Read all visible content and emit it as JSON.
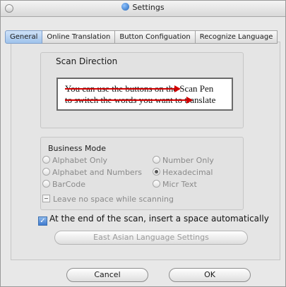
{
  "window": {
    "title": "Settings"
  },
  "tabs": [
    {
      "label": "General"
    },
    {
      "label": "Online Translation"
    },
    {
      "label": "Button Configuation"
    },
    {
      "label": "Recognize Language"
    }
  ],
  "scan_direction": {
    "label": "Scan Direction",
    "preview_line1": "You can use the buttons on the Scan Pen",
    "preview_line2": "to switch the words you want to translate"
  },
  "business_mode": {
    "label": "Business Mode",
    "options": [
      {
        "label": "Alphabet Only",
        "selected": false
      },
      {
        "label": "Number Only",
        "selected": false
      },
      {
        "label": "Alphabet and Numbers",
        "selected": false
      },
      {
        "label": "Hexadecimal",
        "selected": true
      },
      {
        "label": "BarCode",
        "selected": false
      },
      {
        "label": "Micr Text",
        "selected": false
      }
    ],
    "leave_space_label": "Leave no space while scanning"
  },
  "auto_space_label": "At the end of the scan, insert a space automatically",
  "east_asian_button": "East Asian Language Settings",
  "buttons": {
    "cancel": "Cancel",
    "ok": "OK"
  }
}
